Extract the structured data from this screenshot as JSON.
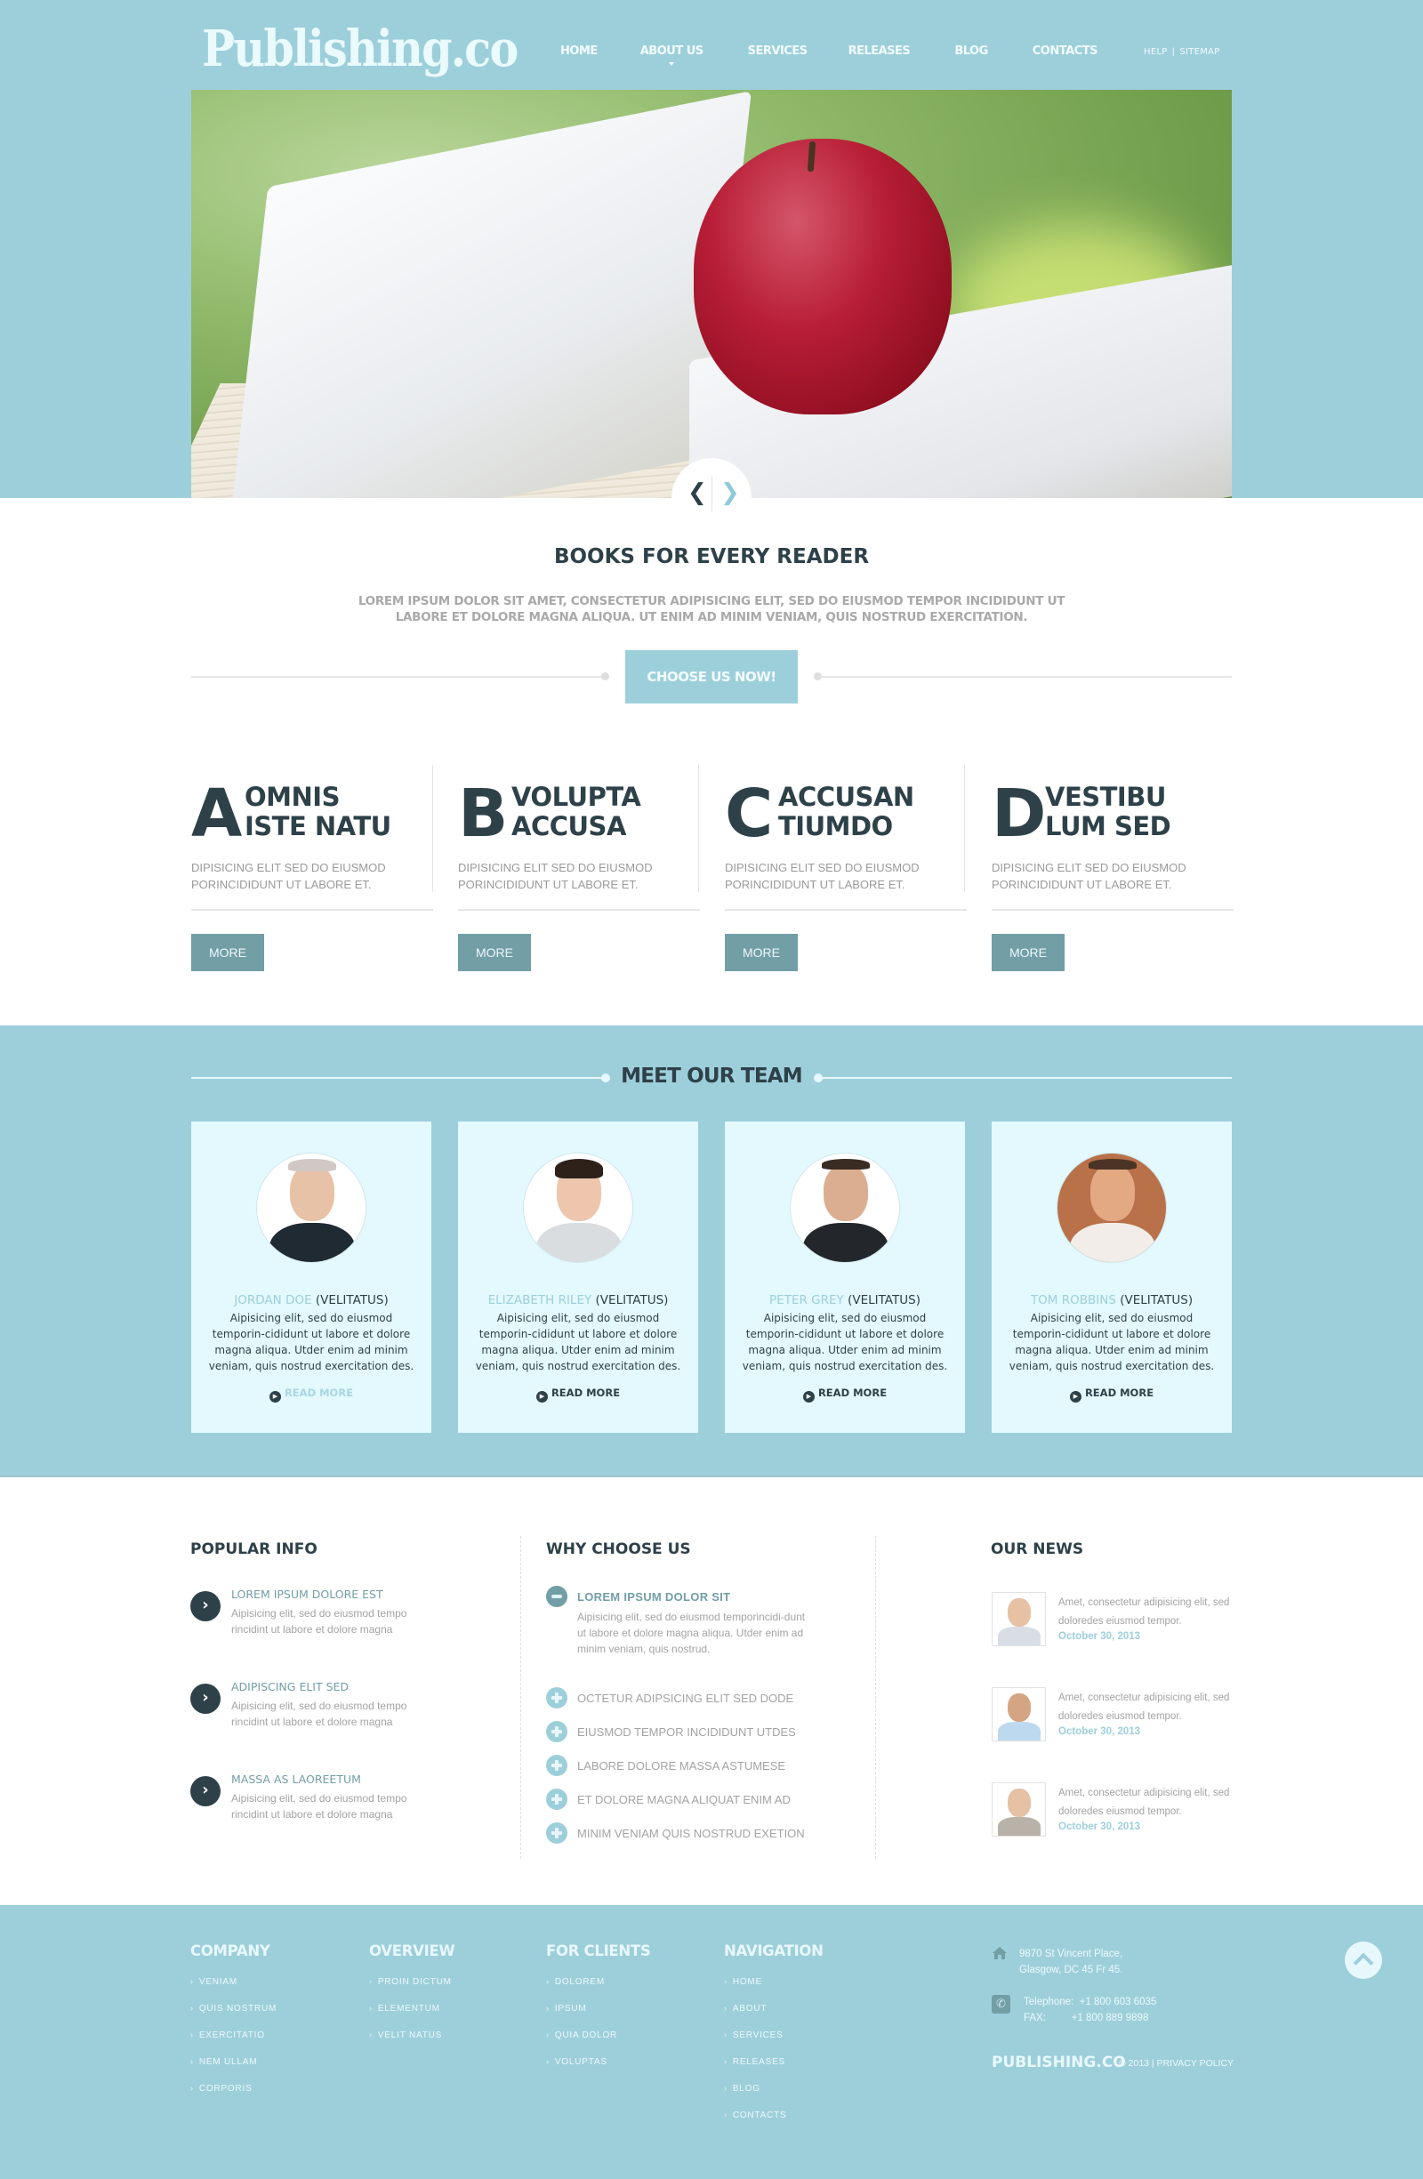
{
  "header": {
    "logo": "Publishing.co",
    "nav": [
      {
        "label": "HOME",
        "active": false
      },
      {
        "label": "ABOUT US",
        "active": true
      },
      {
        "label": "SERVICES",
        "active": false
      },
      {
        "label": "RELEASES",
        "active": false
      },
      {
        "label": "BLOG",
        "active": false
      },
      {
        "label": "CONTACTS",
        "active": false
      }
    ],
    "utility": {
      "help": "HELP",
      "separator": "|",
      "sitemap": "SITEMAP"
    }
  },
  "slider": {
    "prev_icon": "chevron-left-icon",
    "next_icon": "chevron-right-icon",
    "prev_glyph": "❮",
    "next_glyph": "❯"
  },
  "intro": {
    "title": "BOOKS FOR EVERY READER",
    "subtitle": "LOREM IPSUM DOLOR SIT AMET, CONSECTETUR ADIPISICING ELIT, SED DO EIUSMOD TEMPOR INCIDIDUNT UT LABORE ET DOLORE MAGNA ALIQUA. UT ENIM AD MINIM VENIAM, QUIS NOSTRUD EXERCITATION.",
    "button": "CHOOSE US NOW!"
  },
  "features": [
    {
      "letter": "A",
      "title": "OMNIS\nISTE NATU",
      "desc": "DIPISICING ELIT SED DO EIUSMOD PORINCIDIDUNT UT LABORE ET.",
      "button": "MORE"
    },
    {
      "letter": "B",
      "title": "VOLUPTA\nACCUSA",
      "desc": "DIPISICING ELIT SED DO EIUSMOD PORINCIDIDUNT UT LABORE ET.",
      "button": "MORE"
    },
    {
      "letter": "C",
      "title": "ACCUSAN\nTIUMDO",
      "desc": "DIPISICING ELIT SED DO EIUSMOD PORINCIDIDUNT UT LABORE ET.",
      "button": "MORE"
    },
    {
      "letter": "D",
      "title": "VESTIBU\nLUM SED",
      "desc": "DIPISICING ELIT SED DO EIUSMOD PORINCIDIDUNT UT LABORE ET.",
      "button": "MORE"
    }
  ],
  "team": {
    "title": "MEET OUR TEAM",
    "members": [
      {
        "name": "JORDAN DOE",
        "role": "(VELITATUS)",
        "bio": "Aipisicing elit, sed do eiusmod temporin-cididunt ut labore et dolore magna aliqua. Utder enim ad minim veniam, quis nostrud exercitation des.",
        "link": "READ MORE",
        "link_active": true
      },
      {
        "name": "ELIZABETH RILEY",
        "role": "(VELITATUS)",
        "bio": "Aipisicing elit, sed do eiusmod temporin-cididunt ut labore et dolore magna aliqua. Utder enim ad minim veniam, quis nostrud exercitation des.",
        "link": "READ MORE",
        "link_active": false
      },
      {
        "name": "PETER GREY",
        "role": "(VELITATUS)",
        "bio": "Aipisicing elit, sed do eiusmod temporin-cididunt ut labore et dolore magna aliqua. Utder enim ad minim veniam, quis nostrud exercitation des.",
        "link": "READ MORE",
        "link_active": false
      },
      {
        "name": "TOM ROBBINS",
        "role": "(VELITATUS)",
        "bio": "Aipisicing elit, sed do eiusmod temporin-cididunt ut labore et dolore magna aliqua. Utder enim ad minim veniam, quis nostrud exercitation des.",
        "link": "READ MORE",
        "link_active": false
      }
    ]
  },
  "popular": {
    "title": "POPULAR INFO",
    "items": [
      {
        "title": "LOREM IPSUM DOLORE EST",
        "text": "Aipisicing elit, sed do eiusmod tempo rincidint ut labore et dolore magna"
      },
      {
        "title": "ADIPISCING ELIT SED",
        "text": "Aipisicing elit, sed do eiusmod tempo rincidint ut labore et dolore magna"
      },
      {
        "title": "MASSA AS LAOREETUM",
        "text": "Aipisicing elit, sed do eiusmod tempo rincidint ut labore et dolore magna"
      }
    ]
  },
  "why": {
    "title": "WHY CHOOSE US",
    "open_item": {
      "title": "LOREM IPSUM DOLOR SIT",
      "text": "Aipisicing elit, sed do eiusmod temporincidi-dunt ut labore et dolore magna aliqua. Utder enim ad minim veniam, quis nostrud."
    },
    "items": [
      "OCTETUR ADIPSICING ELIT SED DODE",
      "EIUSMOD TEMPOR INCIDIDUNT UTDES",
      "LABORE DOLORE MASSA ASTUMESE",
      "ET DOLORE MAGNA ALIQUAT ENIM AD",
      "MINIM VENIAM QUIS NOSTRUD EXETION"
    ]
  },
  "news": {
    "title": "OUR NEWS",
    "items": [
      {
        "text": "Amet, consectetur adipisicing elit, sed doloredes eiusmod tempor.",
        "date": "October 30, 2013"
      },
      {
        "text": "Amet, consectetur adipisicing elit, sed doloredes eiusmod tempor.",
        "date": "October 30, 2013"
      },
      {
        "text": "Amet, consectetur adipisicing elit, sed doloredes eiusmod tempor.",
        "date": "October 30, 2013"
      }
    ]
  },
  "footer": {
    "columns": [
      {
        "title": "COMPANY",
        "links": [
          "VENIAM",
          "QUIS NOSTRUM",
          "EXERCITATIO",
          "NEM ULLAM",
          "CORPORIS"
        ]
      },
      {
        "title": "OVERVIEW",
        "links": [
          "PROIN DICTUM",
          "ELEMENTUM",
          "VELIT NATUS"
        ]
      },
      {
        "title": "FOR CLIENTS",
        "links": [
          "DOLOREM",
          "IPSUM",
          "QUIA DOLOR",
          "VOLUPTAS"
        ]
      },
      {
        "title": "NAVIGATION",
        "links": [
          "HOME",
          "ABOUT",
          "SERVICES",
          "RELEASES",
          "BLOG",
          "CONTACTS"
        ]
      }
    ],
    "address": "9870 St Vincent Place,\nGlasgow, DC 45 Fr 45.",
    "phone": "Telephone:  +1 800 603 6035\nFAX:         +1 800 889 9898",
    "brand": "PUBLISHING.CO",
    "copyright": "© 2013 | PRIVACY POLICY"
  },
  "colors": {
    "accent": "#9dcfdb",
    "dark": "#2e4149",
    "muted_teal": "#729ea6",
    "card_bg": "#e3f9fe"
  }
}
